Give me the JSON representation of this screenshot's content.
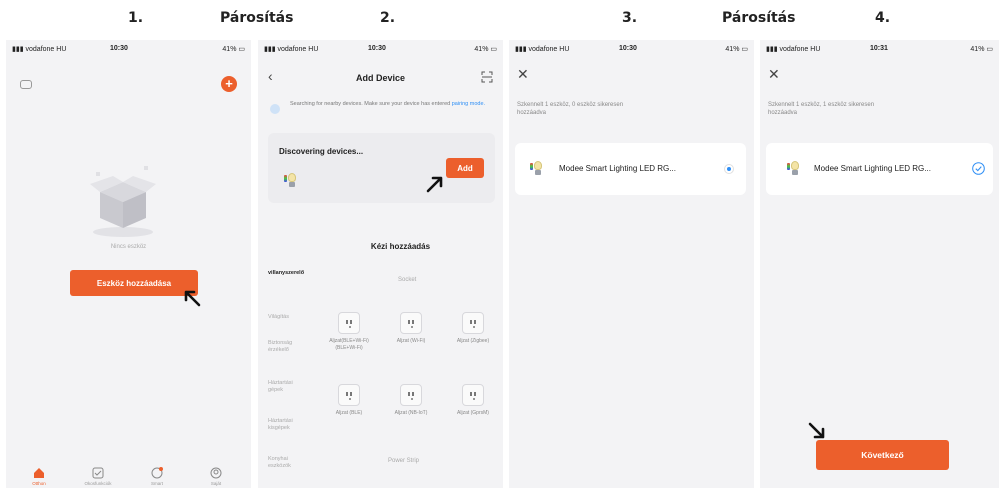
{
  "headings": {
    "step1": "1.",
    "pairing_a": "Párosítás",
    "step2": "2.",
    "step3": "3.",
    "pairing_b": "Párosítás",
    "step4": "4."
  },
  "status_bar": {
    "carrier": "vodafone HU",
    "time_1": "10:30",
    "time_2": "10:30",
    "time_3": "10:30",
    "time_4": "10:31",
    "battery": "41%"
  },
  "screen1": {
    "empty_text": "Nincs eszköz",
    "add_button": "Eszköz hozzáadása",
    "tabs": [
      "Otthon",
      "Okosfunkciók",
      "Smart",
      "Saját"
    ]
  },
  "screen2": {
    "title": "Add Device",
    "search_text": "Searching for nearby devices. Make sure your device has entered",
    "pairing_link": "pairing mode.",
    "discovering": "Discovering devices...",
    "add_button": "Add",
    "manual_title": "Kézi hozzáadás",
    "categories": [
      "villanyszerelő",
      "Világítás",
      "Biztonság érzékelő",
      "Háztartási gépek",
      "Háztartási kisgépek",
      "Konyhai eszközök"
    ],
    "socket_header": "Socket",
    "sockets": [
      "Aljzat(BLE+Wi-Fi) (BLE+Wi-Fi)",
      "Aljzat (Wi-Fi)",
      "Aljzat (Zigbee)",
      "Aljzat (BLE)",
      "Aljzat (NB-IoT)",
      "Aljzat (GprsM)"
    ],
    "power_strip": "Power Strip"
  },
  "screen3": {
    "status_text": "Szkennelt 1 eszköz, 0 eszköz sikeresen hozzáadva",
    "device_name": "Modee Smart Lighting LED RG..."
  },
  "screen4": {
    "status_text": "Szkennelt 1 eszköz, 1 eszköz sikeresen hozzáadva",
    "device_name": "Modee Smart Lighting LED RG...",
    "next_button": "Következő"
  },
  "colors": {
    "accent": "#ec5f2c",
    "link": "#2f8ff5",
    "check": "#2f8ff5"
  }
}
